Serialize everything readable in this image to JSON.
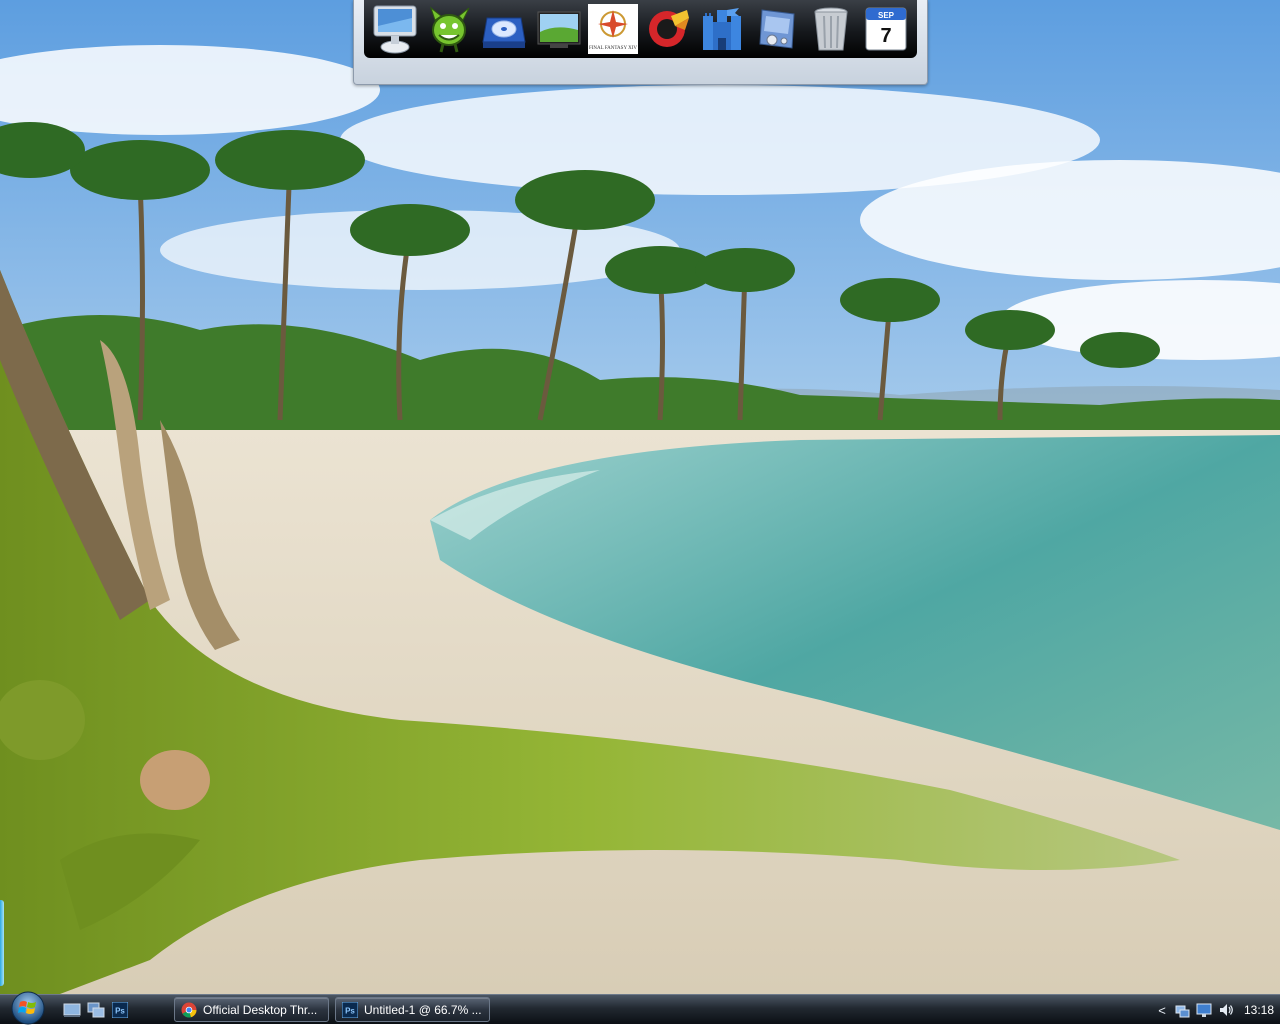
{
  "dock": {
    "items": [
      {
        "name": "computer"
      },
      {
        "name": "green-monster"
      },
      {
        "name": "dvd-drive"
      },
      {
        "name": "desktop-photo"
      },
      {
        "name": "final-fantasy-xiv"
      },
      {
        "name": "ccleaner"
      },
      {
        "name": "network-castle"
      },
      {
        "name": "control-panel"
      },
      {
        "name": "recycle-bin"
      },
      {
        "name": "calendar"
      }
    ],
    "ff_label": "FINAL FANTASY XIV",
    "calendar_month": "SEP",
    "calendar_day": "7"
  },
  "taskbar": {
    "quick_launch": [
      {
        "name": "show-desktop-icon"
      },
      {
        "name": "switch-windows-icon"
      },
      {
        "name": "photoshop-icon"
      }
    ],
    "quick_launch_ps_text": "Ps",
    "tasks": [
      {
        "label": "Official Desktop Thr...",
        "icon": "chrome-icon"
      },
      {
        "label": "Untitled-1 @ 66.7% ...",
        "icon": "photoshop-icon",
        "icon_text": "Ps"
      }
    ],
    "tray": {
      "chevron": "<",
      "icons": [
        "network-icon",
        "display-icon",
        "volume-icon"
      ],
      "clock": "13:18"
    }
  },
  "colors": {
    "taskbar_bg": "#1b222b",
    "dock_frame": "#d5dde7",
    "sky": "#7fb3e6",
    "sea": "#5fb3ad",
    "sand": "#e4dac6",
    "moss": "#8fae2c"
  }
}
